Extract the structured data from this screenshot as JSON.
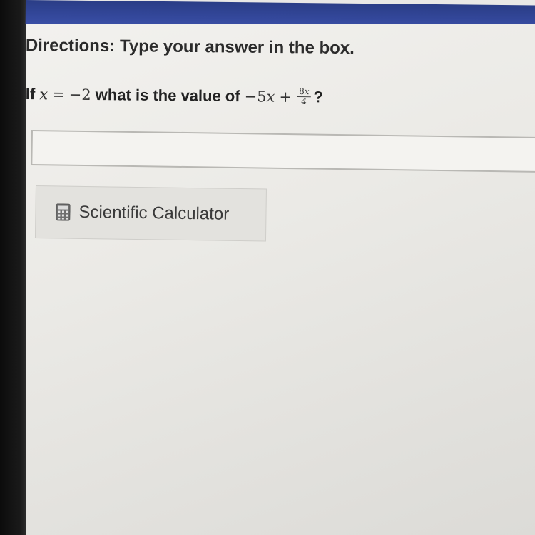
{
  "directions": {
    "label": "Directions:",
    "text": "Type your answer in the box."
  },
  "question": {
    "prefix": "If",
    "var": "x",
    "equals": "=",
    "value": "−2",
    "middle": "what is the value of",
    "term1": "−5",
    "term1_var": "x",
    "plus": "+",
    "frac_num_coef": "8",
    "frac_num_var": "x",
    "frac_den": "4",
    "suffix": "?"
  },
  "answer": {
    "value": "",
    "placeholder": ""
  },
  "calculator": {
    "label": "Scientific Calculator",
    "icon": "calculator-icon"
  },
  "colors": {
    "top_band": "#33479a",
    "background": "#ebeae6",
    "text": "#2b2b2b"
  }
}
